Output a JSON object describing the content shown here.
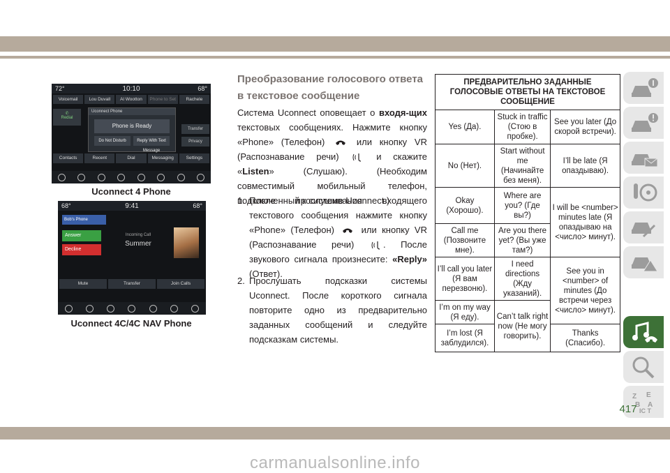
{
  "heading": [
    "Преобразование голосового ответа",
    "в текстовое сообщение"
  ],
  "intro": {
    "t1": "Система Uconnect оповещает о ",
    "t1b": "входя-щих",
    "t2": " текстовых сообщениях. Нажмите кнопку «Phone» (Телефон) ",
    "t3": " или кнопку VR (Распознавание речи) ",
    "t4": " и скажите «",
    "t4b": "Listen",
    "t5": "» (Слушаю). (Необходим совместимый мобильный телефон, подключенный к системе Uconnect.)"
  },
  "steps": [
    {
      "num": "1.",
      "a": "После прослушивания входящего текстового сообщения нажмите кнопку «Phone» (Телефон) ",
      "b": " или кнопку VR (Распознавание речи) ",
      "c": ". После звукового сигнала произнесите: ",
      "bold": "«Reply»",
      "d": " (Ответ)."
    },
    {
      "num": "2.",
      "text": "Прослушать подсказки системы Uconnect. После короткого сигнала повторите одно из предварительно заданных сообщений и следуйте подсказкам системы."
    }
  ],
  "captions": {
    "shot1": "Uconnect 4 Phone",
    "shot2": "Uconnect 4C/4C NAV Phone"
  },
  "screen1": {
    "temp_left": "72°",
    "time": "10:10",
    "temp_right": "68°",
    "chips": [
      "Voicemail",
      "Lou Duvall",
      "Al Wootton",
      "Phone to Set",
      "Rachele"
    ],
    "side_left": "Redial",
    "popup_header": "Uconnect Phone",
    "popup_ready": "Phone is Ready",
    "popup_buttons": [
      "Do Not Disturb",
      "Reply With Text Message"
    ],
    "side_right": [
      "Transfer",
      "Privacy"
    ],
    "buttons": [
      "Contacts",
      "Recent",
      "Dial",
      "Messaging",
      "Settings"
    ]
  },
  "screen2": {
    "temp_left": "68°",
    "time": "9:41",
    "temp_right": "68°",
    "contact": "Bob's Phone",
    "answer": "Answer",
    "decline": "Decline",
    "incoming": "Incoming Call",
    "caller": "Summer",
    "buttons": [
      "Mute",
      "Transfer",
      "Join Calls"
    ]
  },
  "table": {
    "header": "ПРЕДВАРИТЕЛЬНО ЗАДАННЫЕ ГОЛОСОВЫЕ ОТВЕТЫ НА ТЕКСТОВОЕ СООБЩЕНИЕ",
    "c1": [
      "Yes (Да).",
      "No (Нет).",
      "Okay (Хорошо).",
      "Call me (Позвоните мне).",
      "I’ll call you later (Я вам перезвоню).",
      "I’m on my way (Я еду).",
      "I’m lost (Я заблудился)."
    ],
    "c2": [
      "Stuck in traffic (Стою в пробке).",
      "Start without me (Начинайте без меня).",
      "Where are you? (Где вы?)",
      "Are you there yet? (Вы уже там?)",
      "I need directions (Жду указаний).",
      "Can’t talk right now (Не могу говорить)."
    ],
    "c3": [
      "See you later (До скорой встречи).",
      "I’ll be late (Я опаздываю).",
      "I will be <number> minutes late (Я опаздываю на <число> минут).",
      "See you in <number> of minutes (До встречи через <число> минут).",
      "Thanks (Спасибо)."
    ]
  },
  "page_number": "417",
  "watermark": "carmanualsonline.info",
  "icons": [
    "car-info-icon",
    "car-warning-icon",
    "car-mail-icon",
    "key-wheel-icon",
    "car-tools-icon",
    "car-triangle-icon",
    "music-phone-icon",
    "search-icon",
    "alphabet-icon"
  ],
  "colors": {
    "accent": "#3d7137",
    "band": "#b6aa9c",
    "heading": "#7a7370"
  }
}
